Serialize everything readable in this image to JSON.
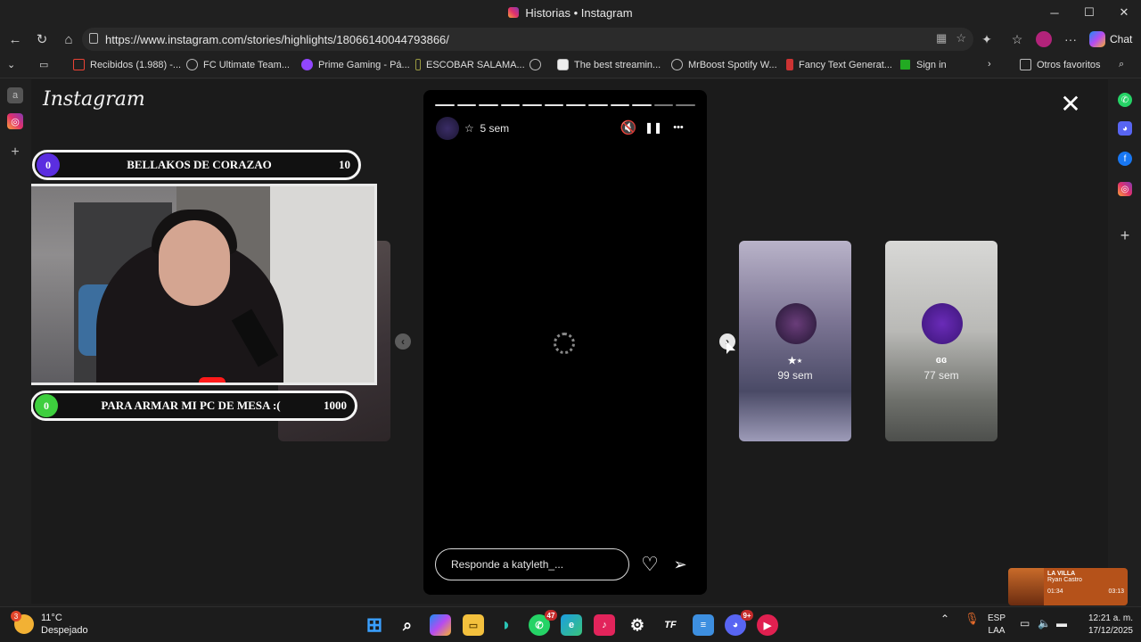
{
  "window": {
    "title": "Historias • Instagram",
    "minimize": "─",
    "maximize": "☐",
    "close": "✕"
  },
  "nav": {
    "back": "←",
    "reload": "↻",
    "home": "⌂",
    "url": "https://www.instagram.com/stories/highlights/18066140044793866/",
    "more": "···",
    "chat_label": "Chat"
  },
  "bookmarks": [
    {
      "label": "Recibidos (1.988) -...",
      "icon": "gmail-icon"
    },
    {
      "label": "FC Ultimate Team...",
      "icon": "globe-icon"
    },
    {
      "label": "Prime Gaming - Pá...",
      "icon": "prime-gaming-icon"
    },
    {
      "label": "ESCOBAR SALAMA...",
      "icon": "bookmark-icon"
    },
    {
      "label": "",
      "icon": "globe-icon"
    },
    {
      "label": "The best streamin...",
      "icon": "streaming-icon"
    },
    {
      "label": "MrBoost Spotify W...",
      "icon": "globe-icon"
    },
    {
      "label": "Fancy Text Generat...",
      "icon": "fancy-text-icon"
    },
    {
      "label": "Sign in",
      "icon": "sat-icon"
    }
  ],
  "bookmarks_other": "Otros favoritos",
  "instagram": {
    "logo": "Instagram",
    "close": "✕",
    "overlay_top": {
      "left": "0",
      "text": "BELLAKOS DE CORAZAO",
      "right": "10"
    },
    "overlay_bottom": {
      "left": "0",
      "text": "PARA ARMAR MI PC DE MESA :(",
      "right": "1000"
    },
    "prev_arrow": "‹",
    "next_arrow": "›",
    "story": {
      "time_ago": "5 sem",
      "star": "☆",
      "mute_icon": "🔇",
      "pause_icon": "❚❚",
      "more_icon": "•••",
      "progress_total": 12,
      "progress_done": 10,
      "reply_placeholder": "Responde a katyleth_...",
      "heart": "♡",
      "send": "➢"
    },
    "next_stories": [
      {
        "name": "★⋆",
        "time": "99 sem"
      },
      {
        "name": "ɞɞ",
        "time": "77 sem"
      }
    ]
  },
  "media": {
    "title": "LA VILLA",
    "artist": "Ryan Castro",
    "elapsed": "01:34",
    "total": "03:13"
  },
  "taskbar": {
    "weather_temp": "11°C",
    "weather_desc": "Despejado",
    "weather_badge": "3",
    "whatsapp_badge": "47",
    "discord_badge": "9+",
    "lang_top": "ESP",
    "lang_bottom": "LAA",
    "time": "12:21 a. m.",
    "date": "17/12/2025"
  }
}
